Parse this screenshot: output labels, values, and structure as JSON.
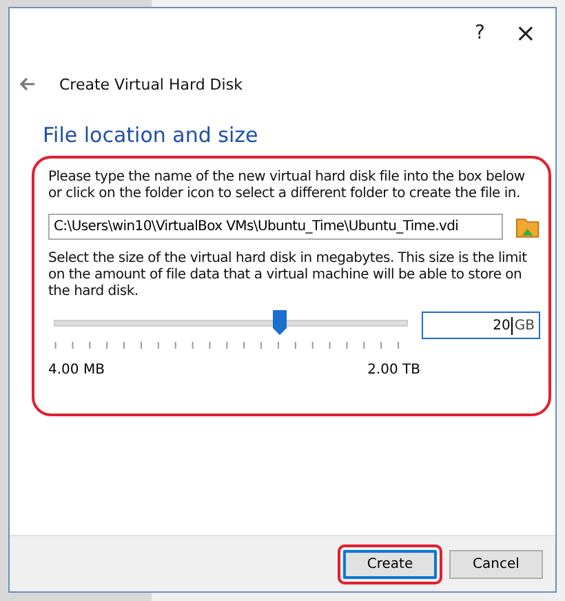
{
  "window": {
    "help": "?",
    "close": "×"
  },
  "header": {
    "title": "Create Virtual Hard Disk"
  },
  "section": {
    "heading": "File location and size"
  },
  "file": {
    "instructions": "Please type the name of the new virtual hard disk file into the box below or click on the folder icon to select a different folder to create the file in.",
    "path": "C:\\Users\\win10\\VirtualBox VMs\\Ubuntu_Time\\Ubuntu_Time.vdi"
  },
  "size": {
    "instructions": "Select the size of the virtual hard disk in megabytes. This size is the limit on the amount of file data that a virtual machine will be able to store on the hard disk.",
    "level": 0.64,
    "value": "20",
    "unit": "GB",
    "min_label": "4.00 MB",
    "max_label": "2.00 TB"
  },
  "buttons": [
    {
      "label": "Create",
      "kind": "default"
    },
    {
      "label": "Cancel",
      "kind": "normal"
    }
  ]
}
